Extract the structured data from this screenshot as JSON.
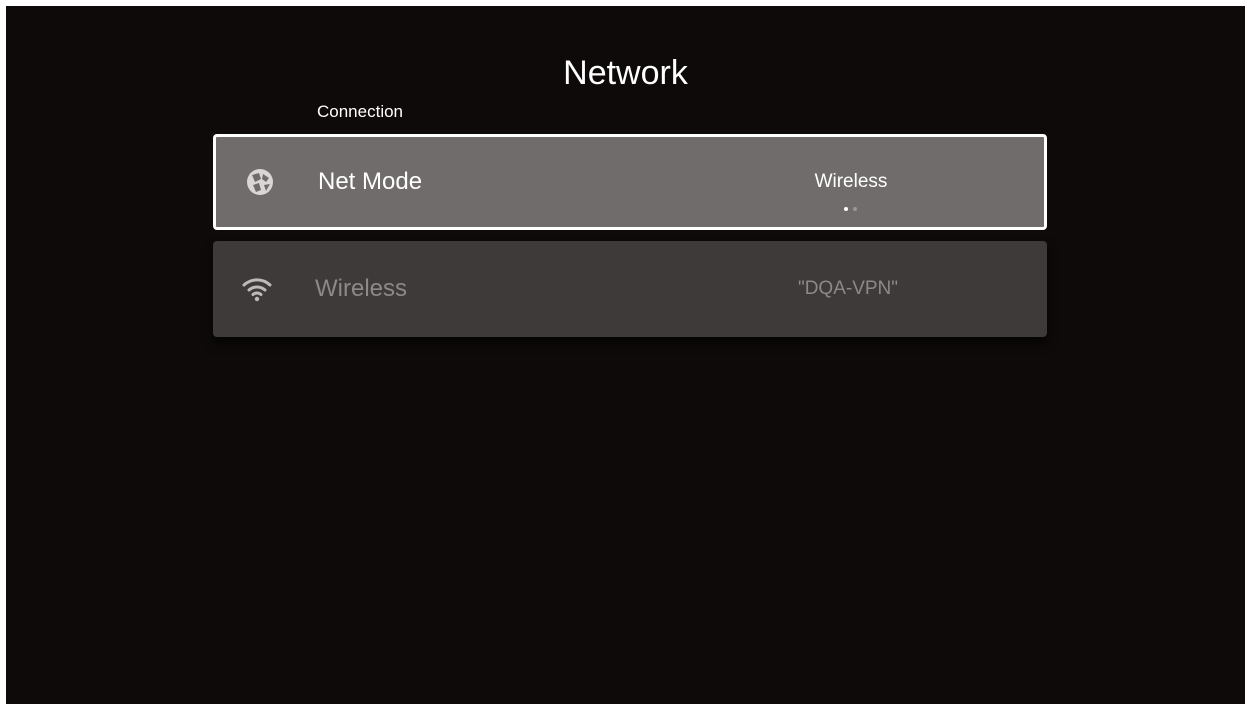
{
  "header": {
    "title": "Network"
  },
  "section": {
    "label": "Connection"
  },
  "rows": [
    {
      "label": "Net Mode",
      "value": "Wireless",
      "icon": "globe-icon",
      "focused": true,
      "option_index": 1,
      "option_count": 2
    },
    {
      "label": "Wireless",
      "value": "\"DQA-VPN\"",
      "icon": "wifi-icon",
      "focused": false
    }
  ],
  "colors": {
    "background": "#0d0a09",
    "focused_row": "#6f6c6b",
    "dim_row": "#3d3a39",
    "focus_border": "#ffffff",
    "dim_text": "#8c8988"
  }
}
